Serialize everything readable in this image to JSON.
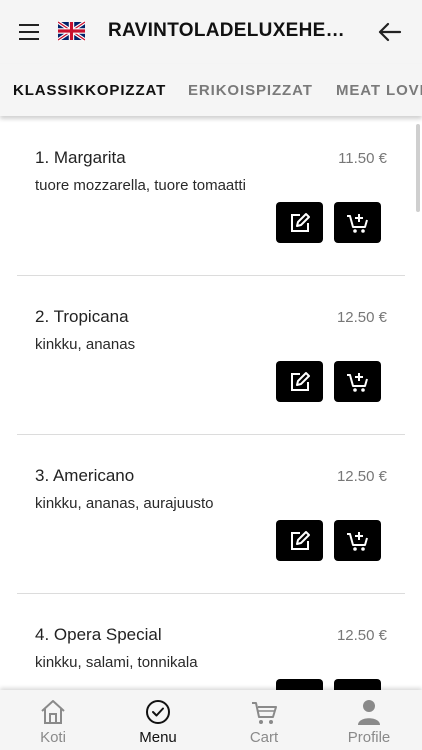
{
  "header": {
    "title": "RAVINTOLADELUXEHERVANTA",
    "menu_icon": "hamburger-menu-icon",
    "flag_icon": "uk-flag-icon",
    "back_icon": "arrow-left-icon"
  },
  "tabs": [
    {
      "label": "KLASSIKKOPIZZAT",
      "active": true
    },
    {
      "label": "ERIKOISPIZZAT",
      "active": false
    },
    {
      "label": "MEAT LOVERS",
      "active": false
    }
  ],
  "items": [
    {
      "name": "1. Margarita",
      "price": "11.50 €",
      "description": "tuore mozzarella, tuore tomaatti"
    },
    {
      "name": "2. Tropicana",
      "price": "12.50 €",
      "description": "kinkku, ananas"
    },
    {
      "name": "3. Americano",
      "price": "12.50 €",
      "description": "kinkku, ananas, aurajuusto"
    },
    {
      "name": "4. Opera Special",
      "price": "12.50 €",
      "description": "kinkku, salami, tonnikala"
    }
  ],
  "item_actions": {
    "edit_icon": "edit-icon",
    "cart_icon": "add-to-cart-icon"
  },
  "bottom_nav": [
    {
      "label": "Koti",
      "icon": "home-icon",
      "active": false
    },
    {
      "label": "Menu",
      "icon": "check-circle-icon",
      "active": true
    },
    {
      "label": "Cart",
      "icon": "cart-icon",
      "active": false
    },
    {
      "label": "Profile",
      "icon": "person-icon",
      "active": false
    }
  ],
  "colors": {
    "bar_background": "#f5f5f5",
    "action_button": "#000000",
    "active_text": "#111111",
    "inactive_text": "#8a8a8a"
  }
}
